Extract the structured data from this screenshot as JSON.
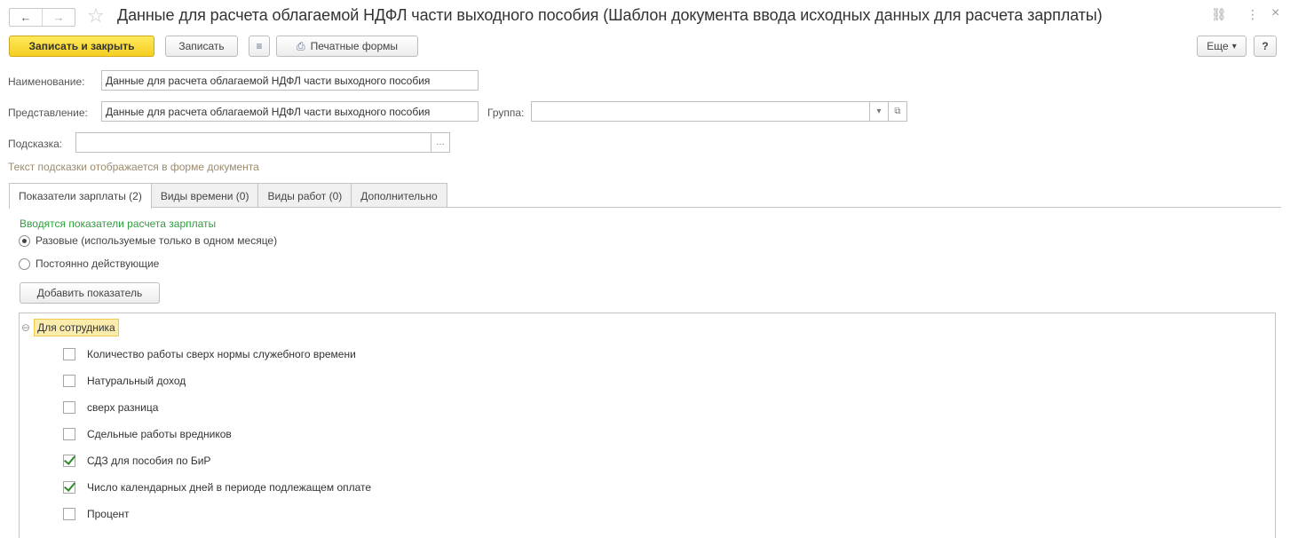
{
  "title": "Данные для расчета облагаемой НДФЛ части выходного пособия (Шаблон документа ввода исходных данных для расчета зарплаты)",
  "icons": {
    "back": "←",
    "forward": "→",
    "star": "☆",
    "link": "⛓",
    "more": "⋮",
    "close": "×",
    "list": "≡",
    "printer": "⎙",
    "dropdown": "▾",
    "open": "⧉",
    "ellipsis": "…",
    "collapse": "⊖"
  },
  "toolbar": {
    "save_close": "Записать и закрыть",
    "save": "Записать",
    "print_forms": "Печатные формы",
    "more": "Еще",
    "help": "?"
  },
  "form": {
    "name_label": "Наименование:",
    "name_value": "Данные для расчета облагаемой НДФЛ части выходного пособия",
    "repr_label": "Представление:",
    "repr_value": "Данные для расчета облагаемой НДФЛ части выходного пособия",
    "group_label": "Группа:",
    "group_value": "",
    "hint_label": "Подсказка:",
    "hint_value": "",
    "hint_note": "Текст подсказки отображается в форме документа"
  },
  "tabs": [
    {
      "label": "Показатели зарплаты (2)",
      "active": true
    },
    {
      "label": "Виды времени (0)",
      "active": false
    },
    {
      "label": "Виды работ (0)",
      "active": false
    },
    {
      "label": "Дополнительно",
      "active": false
    }
  ],
  "indicators": {
    "section_title": "Вводятся показатели расчета зарплаты",
    "radio_once": "Разовые (используемые только в одном месяце)",
    "radio_permanent": "Постоянно действующие",
    "selected": "once",
    "add_button": "Добавить показатель",
    "group": "Для сотрудника",
    "items": [
      {
        "label": "Количество работы сверх нормы служебного времени",
        "checked": false
      },
      {
        "label": "Натуральный доход",
        "checked": false
      },
      {
        "label": "сверх разница",
        "checked": false
      },
      {
        "label": "Сдельные работы вредников",
        "checked": false
      },
      {
        "label": "СДЗ для пособия по БиР",
        "checked": true
      },
      {
        "label": "Число календарных дней в периоде подлежащем оплате",
        "checked": true
      },
      {
        "label": "Процент",
        "checked": false
      }
    ]
  },
  "colors": {
    "primary_button": "#f5cf21",
    "section_title": "#2e9e3e",
    "group_highlight": "#fcecac",
    "check": "#2c8a2c"
  }
}
